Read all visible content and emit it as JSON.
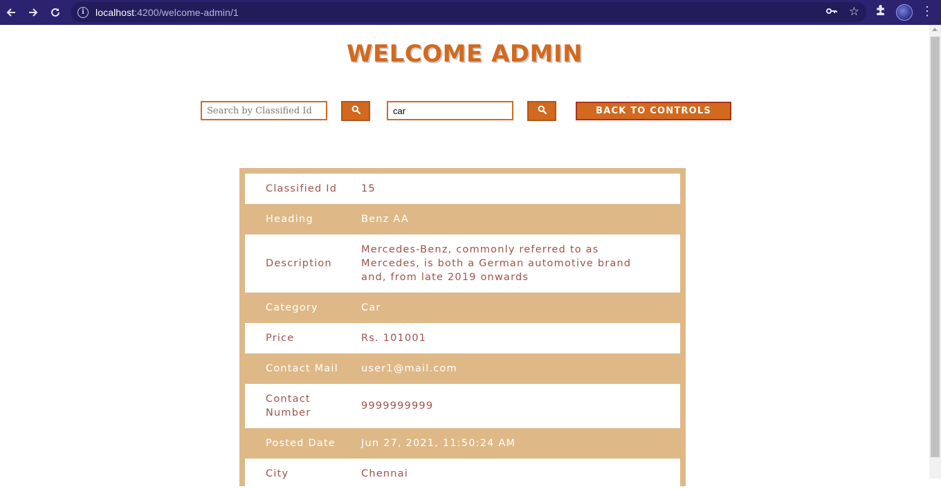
{
  "browser": {
    "url_host": "localhost",
    "url_rest": ":4200/welcome-admin/1"
  },
  "page": {
    "title": "WELCOME ADMIN"
  },
  "controls": {
    "id_search_placeholder": "Search by Classified Id",
    "category_search_value": "car",
    "back_button_label": "BACK TO CONTROLS"
  },
  "details": [
    {
      "label": "Classified Id",
      "value": "15"
    },
    {
      "label": "Heading",
      "value": "Benz AA"
    },
    {
      "label": "Description",
      "value": "Mercedes-Benz, commonly referred to as Mercedes, is both a German automotive brand and, from late 2019 onwards"
    },
    {
      "label": "Category",
      "value": "Car"
    },
    {
      "label": "Price",
      "value": "Rs. 101001"
    },
    {
      "label": "Contact Mail",
      "value": "user1@mail.com"
    },
    {
      "label": "Contact Number",
      "value": "9999999999"
    },
    {
      "label": "Posted Date",
      "value": "Jun 27, 2021, 11:50:24 AM"
    },
    {
      "label": "City",
      "value": "Chennai"
    }
  ],
  "colors": {
    "accent": "#d2691e",
    "card_band": "#deb887",
    "text_dark": "#a0514a",
    "chrome_bg": "#2c2370"
  },
  "icons": [
    "back-arrow-icon",
    "forward-arrow-icon",
    "reload-icon",
    "info-icon",
    "key-icon",
    "star-icon",
    "extensions-icon",
    "avatar",
    "kebab-menu-icon",
    "search-icon"
  ]
}
